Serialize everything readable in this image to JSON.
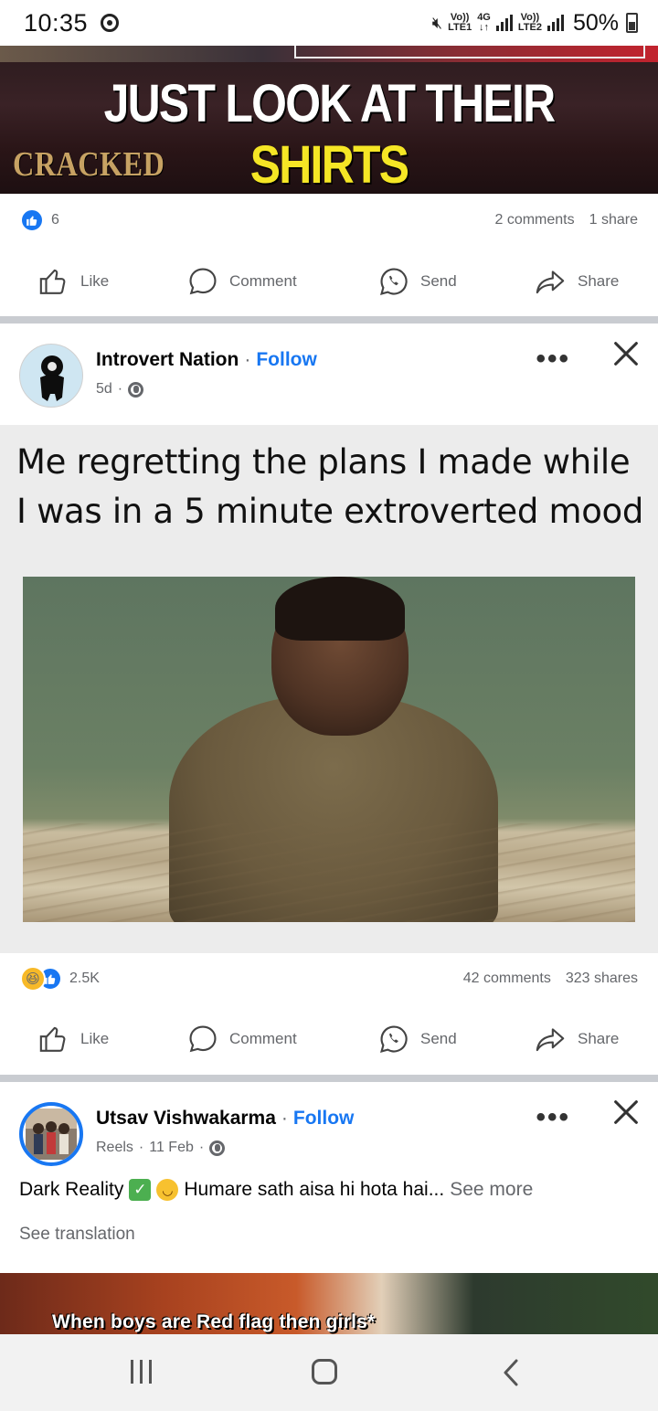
{
  "status_bar": {
    "time": "10:35",
    "sim1_top": "Vo))",
    "sim1_bottom": "LTE1",
    "net_top": "4G",
    "net_bottom": "↓↑",
    "sim2_top": "Vo))",
    "sim2_bottom": "LTE2",
    "battery": "50%"
  },
  "top_post": {
    "media_headline_white": "JUST LOOK AT THEIR ",
    "media_headline_yellow": "SHIRTS",
    "media_brand": "CRACKED",
    "like_count": "6",
    "comments": "2 comments",
    "shares": "1 share"
  },
  "actions": {
    "like": "Like",
    "comment": "Comment",
    "send": "Send",
    "share": "Share"
  },
  "post2": {
    "author": "Introvert Nation",
    "separator": "·",
    "follow": "Follow",
    "time": "5d",
    "meta_sep": "·",
    "meme_caption": "Me regretting the plans I made while I was in a 5 minute extroverted mood",
    "reaction_count": "2.5K",
    "comments": "42 comments",
    "shares": "323 shares"
  },
  "post3": {
    "author": "Utsav Vishwakarma",
    "separator": "·",
    "follow": "Follow",
    "meta_type": "Reels",
    "meta_sep": "·",
    "date": "11 Feb",
    "meta_sep2": "·",
    "text_start": "Dark Reality",
    "text_rest": "Humare sath aisa hi hota hai...",
    "see_more": "See more",
    "see_translation": "See translation",
    "reel_caption": "When boys are Red flag then girls*"
  },
  "colors": {
    "facebook_blue": "#1877f2",
    "secondary_text": "#65676b",
    "divider": "#c9ccd1",
    "headline_yellow": "#f5e625"
  },
  "icons": [
    "chrome-icon",
    "mute-icon",
    "signal-icon",
    "battery-icon",
    "like-reaction-icon",
    "haha-reaction-icon",
    "like-icon",
    "comment-icon",
    "whatsapp-send-icon",
    "share-icon",
    "more-options-icon",
    "close-icon",
    "globe-icon",
    "checkmark-emoji",
    "smile-emoji",
    "recent-apps-icon",
    "home-icon",
    "back-icon"
  ]
}
